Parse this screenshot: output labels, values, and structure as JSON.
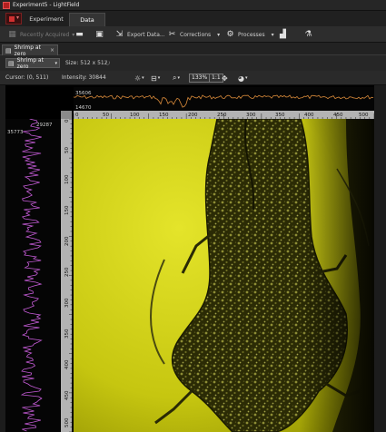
{
  "window": {
    "title": "Experiment5 - LightField"
  },
  "app_tabs": [
    {
      "label": "Experiment"
    },
    {
      "label": "Data"
    }
  ],
  "toolbar": {
    "recently_acquired": "Recently Acquired",
    "export_data": "Export Data...",
    "corrections": "Corrections",
    "processes": "Processes"
  },
  "document_tab": {
    "label": "Shrimp at zero"
  },
  "view": {
    "dataset_select": "Shrimp at zero",
    "size_label": "Size: 512 x 512",
    "cursor_label": "Cursor: (0, 511)",
    "intensity_label": "Intensity: 30844",
    "zoom_level": "133%",
    "one_to_one": "1:1"
  },
  "horizontal_profile": {
    "max_label": "35606",
    "min_label": "14670",
    "line_color": "#d88a3a",
    "x_ticks": [
      "0",
      "50",
      "100",
      "150",
      "200",
      "250",
      "300",
      "350",
      "400",
      "450",
      "500"
    ]
  },
  "vertical_profile": {
    "max_label": "29287",
    "min_label": "35773",
    "line_color": "#c45bd6",
    "y_ticks": [
      "0",
      "50",
      "100",
      "150",
      "200",
      "250",
      "300",
      "350",
      "400",
      "450",
      "500"
    ]
  },
  "image": {
    "tint_color": "#caca10"
  },
  "colors": {
    "accent": "#c62828",
    "toolbar_bg": "#2d2d2d"
  }
}
